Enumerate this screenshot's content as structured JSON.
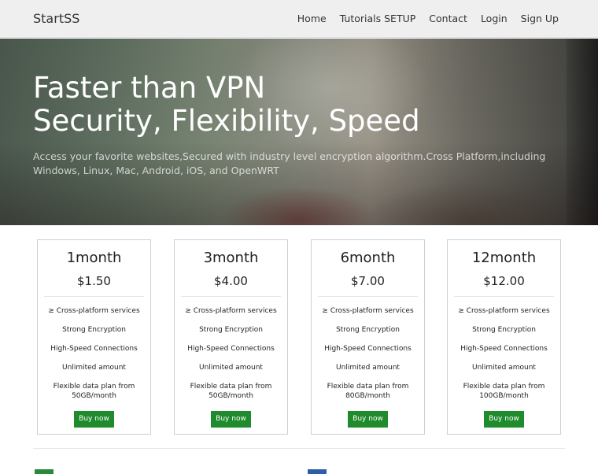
{
  "nav": {
    "brand": "StartSS",
    "links": [
      "Home",
      "Tutorials SETUP",
      "Contact",
      "Login",
      "Sign Up"
    ]
  },
  "hero": {
    "title_line1": "Faster than VPN",
    "title_line2": "Security, Flexibility, Speed",
    "subtitle": "Access your favorite websites,Secured with industry level encryption algorithm.Cross Platform,including Windows, Linux, Mac, Android, iOS, and OpenWRT"
  },
  "plans": [
    {
      "name": "1month",
      "price": "$1.50",
      "features": [
        "≥ Cross-platform services",
        "Strong Encryption",
        "High-Speed Connections",
        "Unlimited amount",
        "Flexible data plan from 50GB/month"
      ],
      "button": "Buy now"
    },
    {
      "name": "3month",
      "price": "$4.00",
      "features": [
        "≥ Cross-platform services",
        "Strong Encryption",
        "High-Speed Connections",
        "Unlimited amount",
        "Flexible data plan from 50GB/month"
      ],
      "button": "Buy now"
    },
    {
      "name": "6month",
      "price": "$7.00",
      "features": [
        "≥ Cross-platform services",
        "Strong Encryption",
        "High-Speed Connections",
        "Unlimited amount",
        "Flexible data plan from 80GB/month"
      ],
      "button": "Buy now"
    },
    {
      "name": "12month",
      "price": "$12.00",
      "features": [
        "≥ Cross-platform services",
        "Strong Encryption",
        "High-Speed Connections",
        "Unlimited amount",
        "Flexible data plan from 100GB/month"
      ],
      "button": "Buy now"
    }
  ],
  "colors": {
    "button_green": "#1f8b2c",
    "navbar_bg": "#efefef"
  }
}
